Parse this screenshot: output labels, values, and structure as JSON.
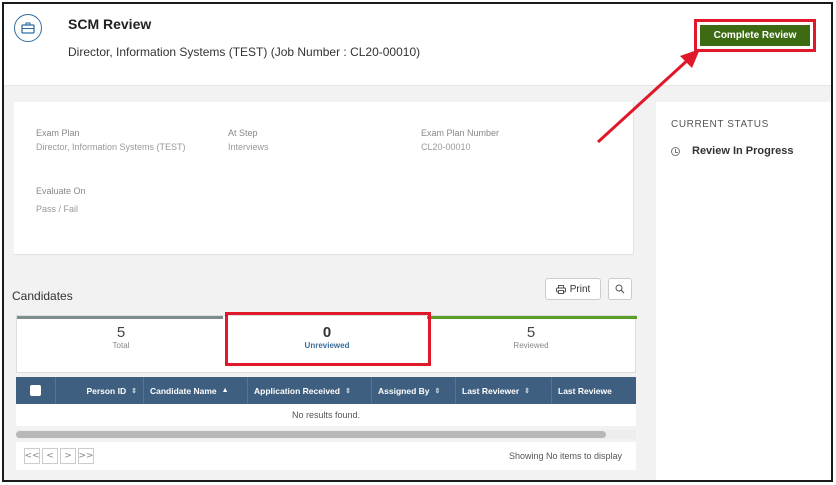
{
  "header": {
    "title": "SCM Review",
    "subtitle": "Director, Information Systems (TEST) (Job Number : CL20-00010)",
    "complete_button": "Complete Review"
  },
  "info": {
    "exam_plan_label": "Exam Plan",
    "exam_plan_value": "Director, Information Systems (TEST)",
    "at_step_label": "At Step",
    "at_step_value": "Interviews",
    "exam_plan_number_label": "Exam Plan Number",
    "exam_plan_number_value": "CL20-00010",
    "evaluate_on_label": "Evaluate On",
    "evaluate_on_value": "Pass / Fail"
  },
  "status": {
    "heading": "CURRENT STATUS",
    "value": "Review In Progress"
  },
  "candidates": {
    "title": "Candidates",
    "print_label": "Print",
    "stats": {
      "total_count": "5",
      "total_label": "Total",
      "unreviewed_count": "0",
      "unreviewed_label": "Unreviewed",
      "reviewed_count": "5",
      "reviewed_label": "Reviewed"
    },
    "columns": [
      "Person ID",
      "Candidate Name",
      "Application Received",
      "Assigned By",
      "Last Reviewer",
      "Last Reviewe"
    ],
    "empty_message": "No results found.",
    "pager_first": "<<",
    "pager_prev": "<",
    "pager_next": ">",
    "pager_last": ">>",
    "showing": "Showing No items to display"
  },
  "colors": {
    "accent_green": "#3d6b14",
    "highlight_red": "#e0192a",
    "table_header": "#3e5f7f"
  }
}
